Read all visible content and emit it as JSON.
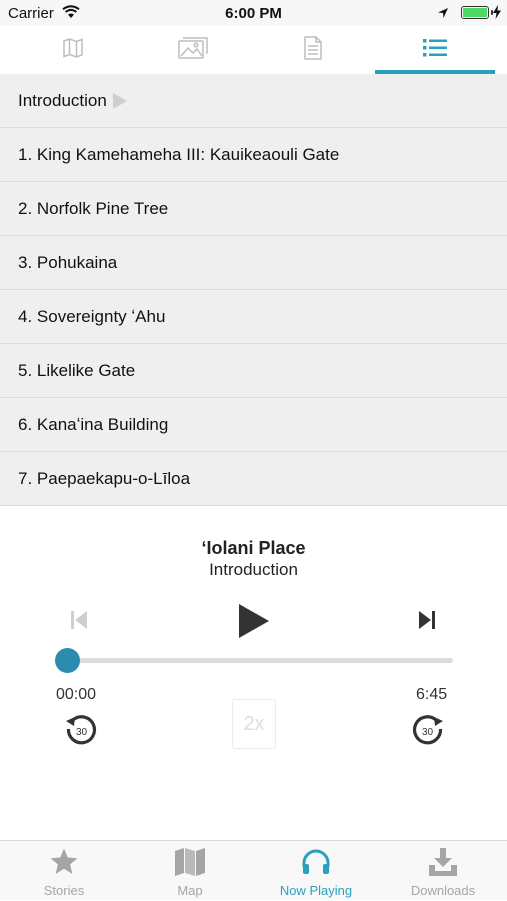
{
  "status_bar": {
    "carrier": "Carrier",
    "time": "6:00 PM"
  },
  "top_tabs": [
    {
      "icon": "map-icon",
      "active": false
    },
    {
      "icon": "gallery-icon",
      "active": false
    },
    {
      "icon": "document-icon",
      "active": false
    },
    {
      "icon": "list-icon",
      "active": true
    }
  ],
  "tracks": [
    {
      "label": "Introduction",
      "playing": true
    },
    {
      "label": "1. King Kamehameha III: Kauikeaouli Gate"
    },
    {
      "label": "2. Norfolk Pine Tree"
    },
    {
      "label": "3. Pohukaina"
    },
    {
      "label": "4. Sovereignty ʻAhu"
    },
    {
      "label": "5. Likelike Gate"
    },
    {
      "label": "6. Kanaʻina Building"
    },
    {
      "label": "7. Paepaekapu-o-Līloa"
    }
  ],
  "player": {
    "title": "ʻIolani Place",
    "subtitle": "Introduction",
    "elapsed": "00:00",
    "duration": "6:45",
    "progress": 0,
    "rewind_seconds": "30",
    "forward_seconds": "30",
    "speed_label": "2x"
  },
  "tab_bar": [
    {
      "label": "Stories",
      "icon": "star-icon",
      "active": false
    },
    {
      "label": "Map",
      "icon": "map-icon",
      "active": false
    },
    {
      "label": "Now Playing",
      "icon": "headphones-icon",
      "active": true
    },
    {
      "label": "Downloads",
      "icon": "download-icon",
      "active": false
    }
  ],
  "colors": {
    "accent": "#2aa0bf",
    "thumb": "#2a8db0",
    "battery": "#4cd964"
  }
}
